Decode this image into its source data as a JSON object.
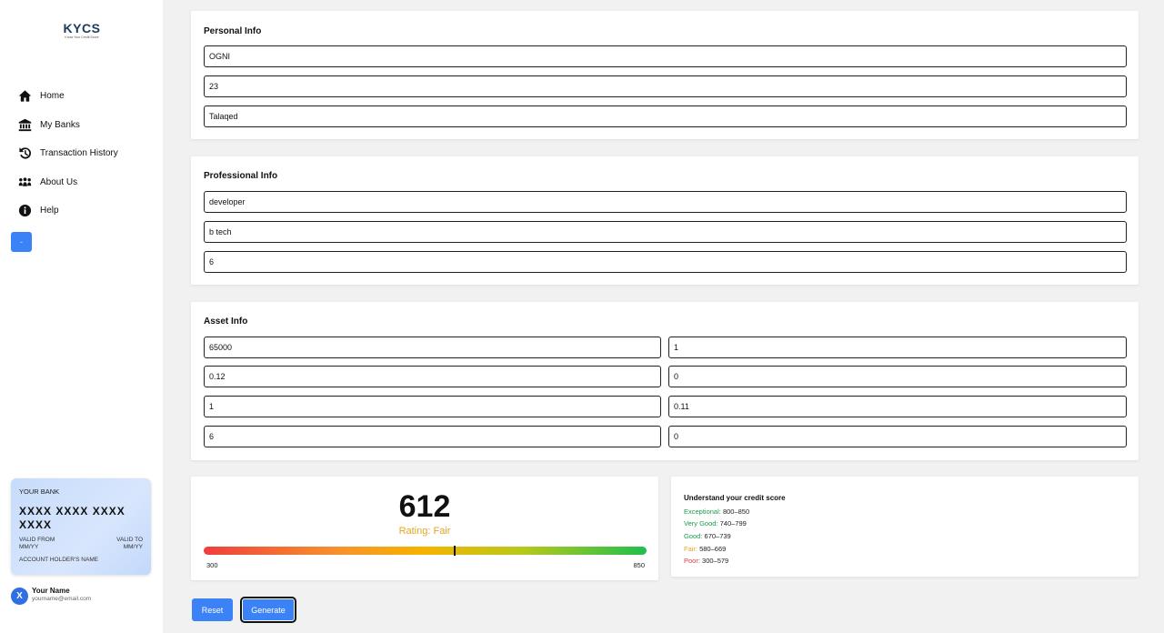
{
  "logo": {
    "text": "KYCS",
    "tagline": "Know Your Credit Score"
  },
  "sidebar": {
    "items": [
      {
        "label": "Home",
        "icon": "home-icon"
      },
      {
        "label": "My Banks",
        "icon": "bank-icon"
      },
      {
        "label": "Transaction History",
        "icon": "history-icon"
      },
      {
        "label": "About Us",
        "icon": "users-icon"
      },
      {
        "label": "Help",
        "icon": "info-icon"
      }
    ],
    "collapse_label": "-"
  },
  "card": {
    "bank": "YOUR BANK",
    "number": "XXXX XXXX XXXX XXXX",
    "valid_from_label": "VALID FROM",
    "valid_from_value": "MM/YY",
    "valid_to_label": "VALID TO",
    "valid_to_value": "MM/YY",
    "holder": "ACCOUNT HOLDER'S NAME"
  },
  "user": {
    "initial": "X",
    "name": "Your Name",
    "email": "yourname@email.com"
  },
  "personal": {
    "title": "Personal Info",
    "fields": [
      "OGNI",
      "23",
      "Talaqed"
    ]
  },
  "professional": {
    "title": "Professional Info",
    "fields": [
      "developer",
      "b tech",
      "6"
    ]
  },
  "asset": {
    "title": "Asset Info",
    "left": [
      "65000",
      "0.12",
      "1",
      "6"
    ],
    "right": [
      "1",
      "0",
      "0.11",
      "0"
    ]
  },
  "score": {
    "value": "612",
    "rating": "Rating: Fair",
    "min": "300",
    "max": "850",
    "numeric": 612,
    "range": [
      300,
      850
    ]
  },
  "legend": {
    "title": "Understand your credit score",
    "items": [
      {
        "label": "Exceptional:",
        "range": "800–850",
        "color": "#1a9c4a"
      },
      {
        "label": "Very Good:",
        "range": "740–799",
        "color": "#1a9c4a"
      },
      {
        "label": "Good:",
        "range": "670–739",
        "color": "#1a9c4a"
      },
      {
        "label": "Fair:",
        "range": "580–669",
        "color": "#e6a41f"
      },
      {
        "label": "Poor:",
        "range": "300–579",
        "color": "#e03a3a"
      }
    ]
  },
  "actions": {
    "reset": "Reset",
    "generate": "Generate"
  },
  "colors": {
    "accent": "#3b82f6",
    "fair": "#e6a41f"
  }
}
